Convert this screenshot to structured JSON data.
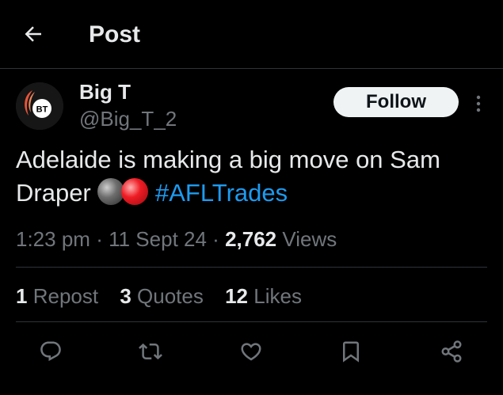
{
  "header": {
    "title": "Post",
    "back_icon": "arrow-left-icon"
  },
  "author": {
    "display_name": "Big T",
    "handle": "@Big_T_2",
    "avatar_text": "BT",
    "follow_label": "Follow",
    "more_icon": "more-vertical-icon"
  },
  "tweet": {
    "text_before": "Adelaide is making a big move on Sam Draper",
    "emojis": [
      "black-ball-emoji",
      "red-ball-emoji"
    ],
    "hashtag": "#AFLTrades"
  },
  "meta": {
    "time": "1:23 pm",
    "separator": "·",
    "date": "11 Sept 24",
    "views_count": "2,762",
    "views_label": "Views"
  },
  "stats": {
    "reposts_count": "1",
    "reposts_label": "Repost",
    "quotes_count": "3",
    "quotes_label": "Quotes",
    "likes_count": "12",
    "likes_label": "Likes"
  },
  "actions": [
    "reply-icon",
    "repost-icon",
    "like-icon",
    "bookmark-icon",
    "share-icon"
  ],
  "colors": {
    "background": "#000000",
    "text_primary": "#e7e9ea",
    "text_secondary": "#71767b",
    "accent": "#1d9bf0",
    "divider": "#2f3336",
    "follow_button_bg": "#eff3f4"
  }
}
